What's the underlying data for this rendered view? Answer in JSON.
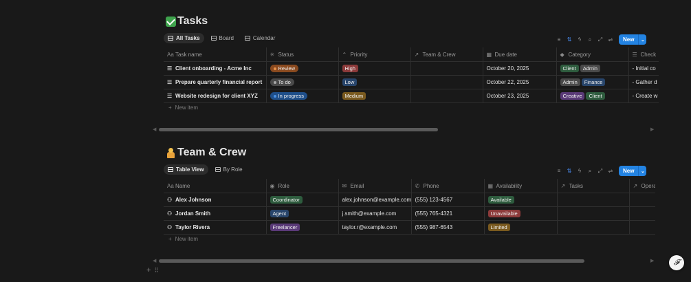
{
  "tasks": {
    "title": "Tasks",
    "views": [
      {
        "label": "All Tasks",
        "active": true
      },
      {
        "label": "Board",
        "active": false
      },
      {
        "label": "Calendar",
        "active": false
      }
    ],
    "new_label": "New",
    "columns": [
      "Task name",
      "Status",
      "Priority",
      "Team & Crew",
      "Due date",
      "Category",
      "Check"
    ],
    "rows": [
      {
        "name": "Client onboarding - Acme Inc",
        "status": "Review",
        "priority": "High",
        "crew": "",
        "due": "October 20, 2025",
        "categories": [
          "Client",
          "Admin"
        ],
        "check": "- Initial co"
      },
      {
        "name": "Prepare quarterly financial report",
        "status": "To do",
        "priority": "Low",
        "crew": "",
        "due": "October 22, 2025",
        "categories": [
          "Admin",
          "Finance"
        ],
        "check": "- Gather d"
      },
      {
        "name": "Website redesign for client XYZ",
        "status": "In progress",
        "priority": "Medium",
        "crew": "",
        "due": "October 23, 2025",
        "categories": [
          "Creative",
          "Client"
        ],
        "check": "- Create w"
      }
    ],
    "new_item": "New item"
  },
  "crew": {
    "title": "Team & Crew",
    "views": [
      {
        "label": "Table View",
        "active": true
      },
      {
        "label": "By Role",
        "active": false
      }
    ],
    "new_label": "New",
    "columns": [
      "Name",
      "Role",
      "Email",
      "Phone",
      "Availability",
      "Tasks",
      "Opera"
    ],
    "rows": [
      {
        "name": "Alex Johnson",
        "role": "Coordinator",
        "email": "alex.johnson@example.com",
        "phone": "(555) 123-4567",
        "availability": "Available",
        "tasks": "",
        "opera": ""
      },
      {
        "name": "Jordan Smith",
        "role": "Agent",
        "email": "j.smith@example.com",
        "phone": "(555) 765-4321",
        "availability": "Unavailable",
        "tasks": "",
        "opera": ""
      },
      {
        "name": "Taylor Rivera",
        "role": "Freelancer",
        "email": "taylor.r@example.com",
        "phone": "(555) 987-6543",
        "availability": "Limited",
        "tasks": "",
        "opera": ""
      }
    ],
    "new_item": "New item"
  },
  "colors": {
    "status": {
      "Review": "#8a4a1f",
      "To do": "#4a4a4a",
      "In progress": "#1f4f8a"
    },
    "status_dot": {
      "Review": "#e8914a",
      "To do": "#a8a8a8",
      "In progress": "#4a90e2"
    },
    "priority": {
      "High": "#8c3a3a",
      "Low": "#28456b",
      "Medium": "#7a5a1f"
    },
    "category": {
      "Client": "#2e5c3e",
      "Admin": "#4a4a4a",
      "Finance": "#28456b",
      "Creative": "#5a3a78"
    },
    "role": {
      "Coordinator": "#2e5c3e",
      "Agent": "#28456b",
      "Freelancer": "#5a3a78"
    },
    "availability": {
      "Available": "#2e5c3e",
      "Unavailable": "#8c3a3a",
      "Limited": "#7a5a1f"
    },
    "accent": "#2383e2"
  },
  "fab_label": "𝓕"
}
